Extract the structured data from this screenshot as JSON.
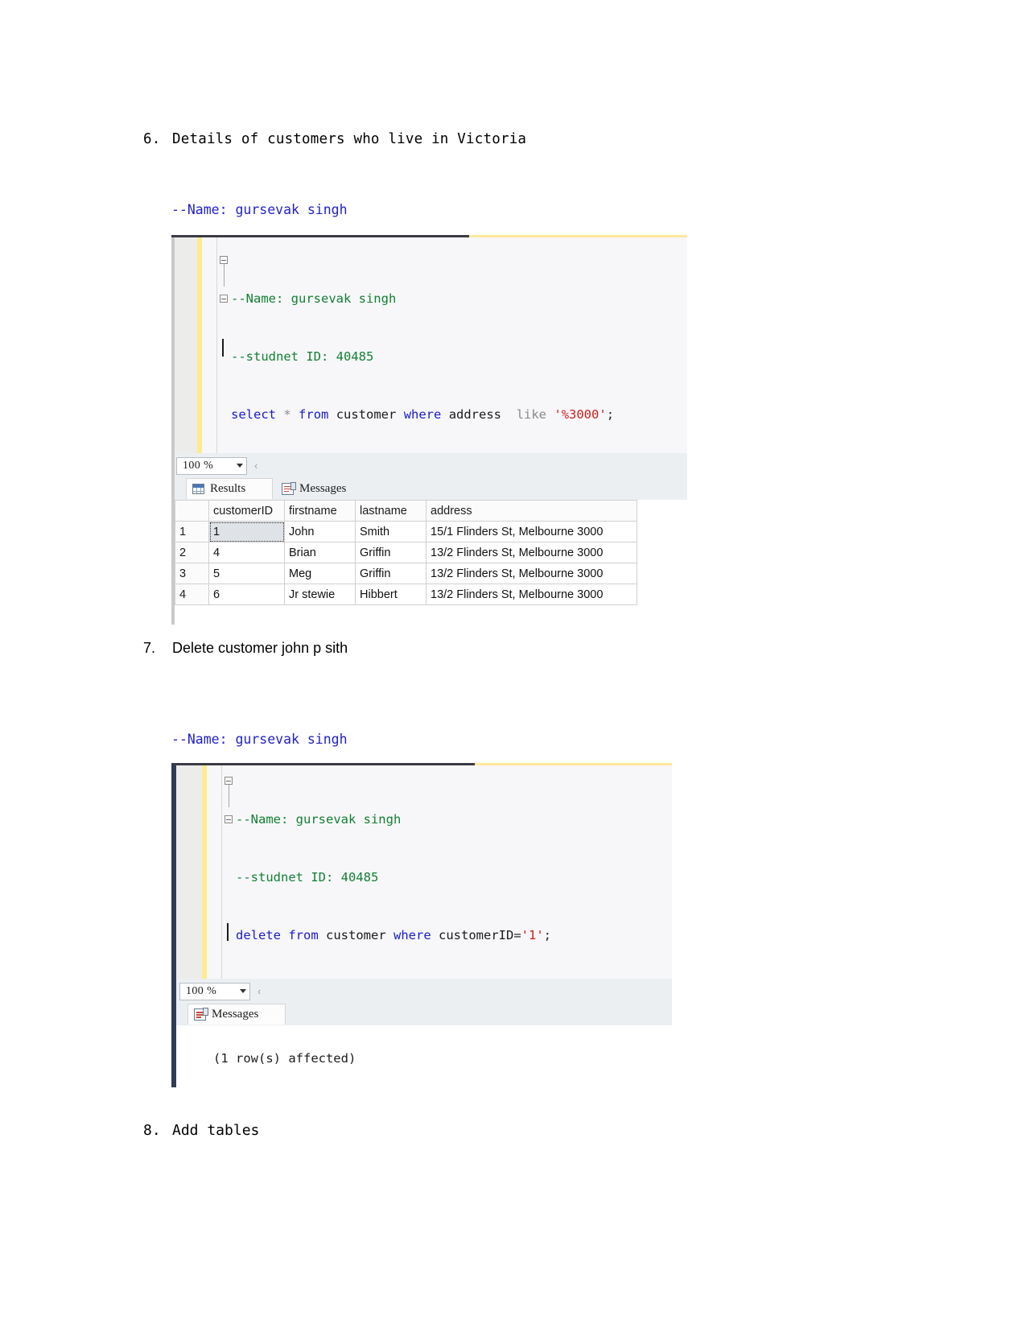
{
  "document": {
    "items": [
      {
        "number": "6.",
        "text": "Details of customers who live in Victoria"
      },
      {
        "number": "7.",
        "text": "Delete customer john p sith"
      },
      {
        "number": "8.",
        "text": "Add tables"
      }
    ],
    "code_listings": [
      {
        "id": "listing-6",
        "lines": [
          "--Name: gursevak singh",
          "--studnet ID: 40485",
          "select * from customer where address  like '%3000';"
        ]
      },
      {
        "id": "listing-7",
        "lines": [
          "--Name: gursevak singh",
          "--studnet ID: 40485",
          "delete from customer where customerID='1';"
        ]
      }
    ]
  },
  "ssms_1": {
    "editor": {
      "lines": [
        {
          "segments": [
            {
              "text": "--Name: gursevak singh",
              "kind": "comment"
            }
          ]
        },
        {
          "segments": [
            {
              "text": "--studnet ID: 40485",
              "kind": "comment"
            }
          ]
        },
        {
          "segments": [
            {
              "text": "select",
              "kind": "keyword"
            },
            {
              "text": " ",
              "kind": "plain"
            },
            {
              "text": "*",
              "kind": "gray"
            },
            {
              "text": " ",
              "kind": "plain"
            },
            {
              "text": "from",
              "kind": "keyword"
            },
            {
              "text": " customer ",
              "kind": "plain"
            },
            {
              "text": "where",
              "kind": "keyword"
            },
            {
              "text": " address  ",
              "kind": "plain"
            },
            {
              "text": "like",
              "kind": "gray"
            },
            {
              "text": " ",
              "kind": "plain"
            },
            {
              "text": "'%3000'",
              "kind": "string"
            },
            {
              "text": ";",
              "kind": "op"
            }
          ]
        }
      ]
    },
    "zoom_level": "100 %",
    "tabs": [
      {
        "label": "Results",
        "icon": "grid-icon",
        "active": true
      },
      {
        "label": "Messages",
        "icon": "messages-icon",
        "active": false
      }
    ],
    "results_grid": {
      "columns": [
        "",
        "customerID",
        "firstname",
        "lastname",
        "address"
      ],
      "rows": [
        {
          "n": "1",
          "customerID": "1",
          "firstname": "John",
          "lastname": "Smith",
          "address": "15/1 Flinders St, Melbourne 3000",
          "selected": true
        },
        {
          "n": "2",
          "customerID": "4",
          "firstname": "Brian",
          "lastname": "Griffin",
          "address": "13/2 Flinders St, Melbourne 3000",
          "selected": false
        },
        {
          "n": "3",
          "customerID": "5",
          "firstname": "Meg",
          "lastname": "Griffin",
          "address": "13/2 Flinders St, Melbourne 3000",
          "selected": false
        },
        {
          "n": "4",
          "customerID": "6",
          "firstname": "Jr stewie",
          "lastname": "Hibbert",
          "address": "13/2 Flinders St, Melbourne 3000",
          "selected": false
        }
      ]
    }
  },
  "ssms_2": {
    "editor": {
      "lines": [
        {
          "segments": [
            {
              "text": "--Name: gursevak singh",
              "kind": "comment"
            }
          ]
        },
        {
          "segments": [
            {
              "text": "--studnet ID: 40485",
              "kind": "comment"
            }
          ]
        },
        {
          "segments": [
            {
              "text": "delete",
              "kind": "keyword"
            },
            {
              "text": " ",
              "kind": "plain"
            },
            {
              "text": "from",
              "kind": "keyword"
            },
            {
              "text": " customer ",
              "kind": "plain"
            },
            {
              "text": "where",
              "kind": "keyword"
            },
            {
              "text": " customerID",
              "kind": "plain"
            },
            {
              "text": "=",
              "kind": "op"
            },
            {
              "text": "'1'",
              "kind": "string"
            },
            {
              "text": ";",
              "kind": "op"
            }
          ]
        }
      ]
    },
    "zoom_level": "100 %",
    "tabs": [
      {
        "label": "Messages",
        "icon": "messages-icon",
        "active": true
      }
    ],
    "messages_output": "(1 row(s) affected)"
  },
  "colors": {
    "doc_code_blue": "#2222cc",
    "sql_comment_green": "#128034",
    "sql_keyword_blue": "#1a1ad0",
    "sql_string_red": "#cc2020",
    "change_bar_yellow": "#ffeb8e",
    "ssms_frame_navy": "#2e3d55"
  }
}
